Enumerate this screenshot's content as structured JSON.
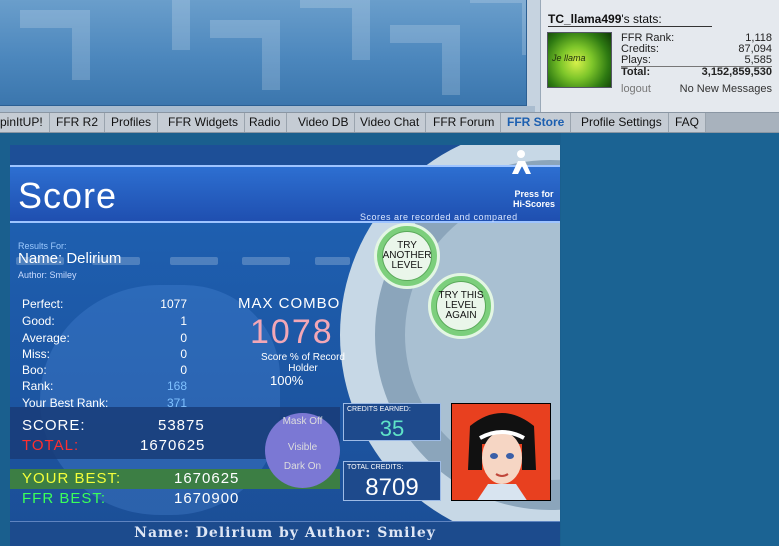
{
  "stats": {
    "username": "TC_llama499",
    "title_suffix": "'s stats:",
    "avatar_text": "Je llama",
    "rows": [
      {
        "label": "FFR Rank:",
        "value": "1,118"
      },
      {
        "label": "Credits:",
        "value": "87,094"
      },
      {
        "label": "Plays:",
        "value": "5,585"
      },
      {
        "label": "Total:",
        "value": "3,152,859,530"
      }
    ],
    "logout": "logout",
    "messages": "No New Messages"
  },
  "nav": {
    "items": [
      "pinItUP!",
      "FFR R2",
      "Profiles",
      "FFR Widgets",
      "Radio",
      "Video DB",
      "Video Chat",
      "FFR Forum",
      "FFR Store",
      "Profile Settings",
      "FAQ"
    ],
    "active": "FFR Store"
  },
  "game": {
    "title": "Score",
    "press_for": "Press for",
    "hi_scores": "Hi-Scores",
    "recorded": "Scores are recorded and compared",
    "try_another": "TRY ANOTHER LEVEL",
    "try_again": "TRY THIS LEVEL AGAIN",
    "results_for": "Results For:",
    "song_name": "Name: Delirium",
    "song_author": "Author: Smiley",
    "judgements": [
      {
        "label": "Perfect:",
        "value": "1077"
      },
      {
        "label": "Good:",
        "value": "1"
      },
      {
        "label": "Average:",
        "value": "0"
      },
      {
        "label": "Miss:",
        "value": "0"
      },
      {
        "label": "Boo:",
        "value": "0"
      },
      {
        "label": "Rank:",
        "value": "168"
      },
      {
        "label": "Your Best Rank:",
        "value": "371"
      }
    ],
    "max_combo_label": "MAX COMBO",
    "max_combo_value": "1078",
    "score_pct_label": "Score % of Record Holder",
    "score_pct_value": "100%",
    "score_label": "SCORE:",
    "score_value": "53875",
    "total_label": "TOTAL:",
    "total_value": "1670625",
    "your_best_label": "YOUR BEST:",
    "your_best_value": "1670625",
    "ffr_best_label": "FFR BEST:",
    "ffr_best_value": "1670900",
    "toggle": {
      "mask_off": "Mask Off",
      "visible": "Visible",
      "dark_on": "Dark On"
    },
    "credits_earned_label": "CREDITS EARNED:",
    "credits_earned_value": "35",
    "total_credits_label": "TOTAL CREDITS:",
    "total_credits_value": "8709",
    "bottom_title": "Name: Delirium by Author: Smiley"
  }
}
